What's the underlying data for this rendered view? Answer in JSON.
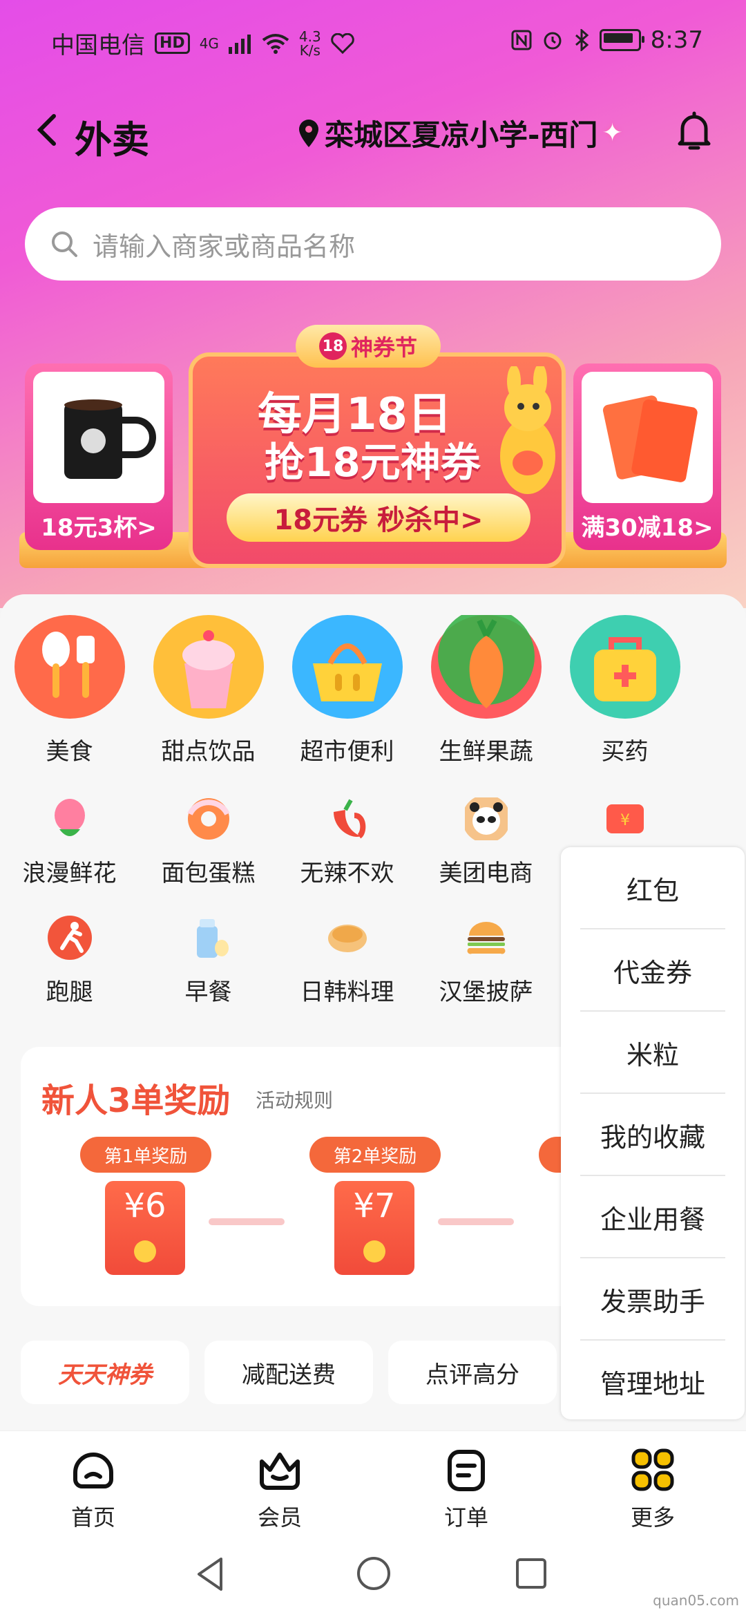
{
  "status": {
    "carrier": "中国电信",
    "hd": "HD",
    "net": "4G",
    "speed_top": "4.3",
    "speed_bottom": "K/s",
    "time": "8:37"
  },
  "nav": {
    "title": "外卖",
    "location": "栾城区夏凉小学-西门"
  },
  "search": {
    "placeholder": "请输入商家或商品名称"
  },
  "banner": {
    "fest_number": "18",
    "fest_label": "神券节",
    "line1": "每月18日",
    "line2": "抢18元神券",
    "cta": "18元券 秒杀中>",
    "left_card": "18元3杯>",
    "right_card": "满30减18>"
  },
  "big_categories": [
    {
      "label": "美食",
      "color": "#ff6a4a"
    },
    {
      "label": "甜点饮品",
      "color": "#ffbf3a"
    },
    {
      "label": "超市便利",
      "color": "#3bb7ff"
    },
    {
      "label": "生鲜果蔬",
      "color": "#ff5a5f"
    },
    {
      "label": "买药",
      "color": "#3ecfb0"
    }
  ],
  "small_categories_row1": [
    {
      "label": "浪漫鲜花",
      "color": "#ff7fa0"
    },
    {
      "label": "面包蛋糕",
      "color": "#ff8a4a"
    },
    {
      "label": "无辣不欢",
      "color": "#f04a3a"
    },
    {
      "label": "美团电商",
      "color": "#f6c38a"
    },
    {
      "label": "",
      "color": "#ff5a4a"
    }
  ],
  "small_categories_row2": [
    {
      "label": "跑腿",
      "color": "#f2553b"
    },
    {
      "label": "早餐",
      "color": "#9fd0f6"
    },
    {
      "label": "日韩料理",
      "color": "#f6c27a"
    },
    {
      "label": "汉堡披萨",
      "color": "#f6a94a"
    }
  ],
  "newbie": {
    "title": "新人3单奖励",
    "rules": "活动规则",
    "rewards": [
      {
        "tag": "第1单奖励",
        "amount": "¥6"
      },
      {
        "tag": "第2单奖励",
        "amount": "¥7"
      }
    ]
  },
  "chips": [
    "天天神券",
    "减配送费",
    "点评高分"
  ],
  "dropdown": [
    "红包",
    "代金券",
    "米粒",
    "我的收藏",
    "企业用餐",
    "发票助手",
    "管理地址"
  ],
  "bottom_nav": [
    {
      "label": "首页",
      "icon": "home-icon"
    },
    {
      "label": "会员",
      "icon": "crown-icon"
    },
    {
      "label": "订单",
      "icon": "order-icon"
    },
    {
      "label": "更多",
      "icon": "grid-icon"
    }
  ],
  "watermark": "quan05.com",
  "colors": {
    "accent_orange": "#f0533a",
    "gradient_top": "#e44de8",
    "more_icon": "#f6c000"
  }
}
